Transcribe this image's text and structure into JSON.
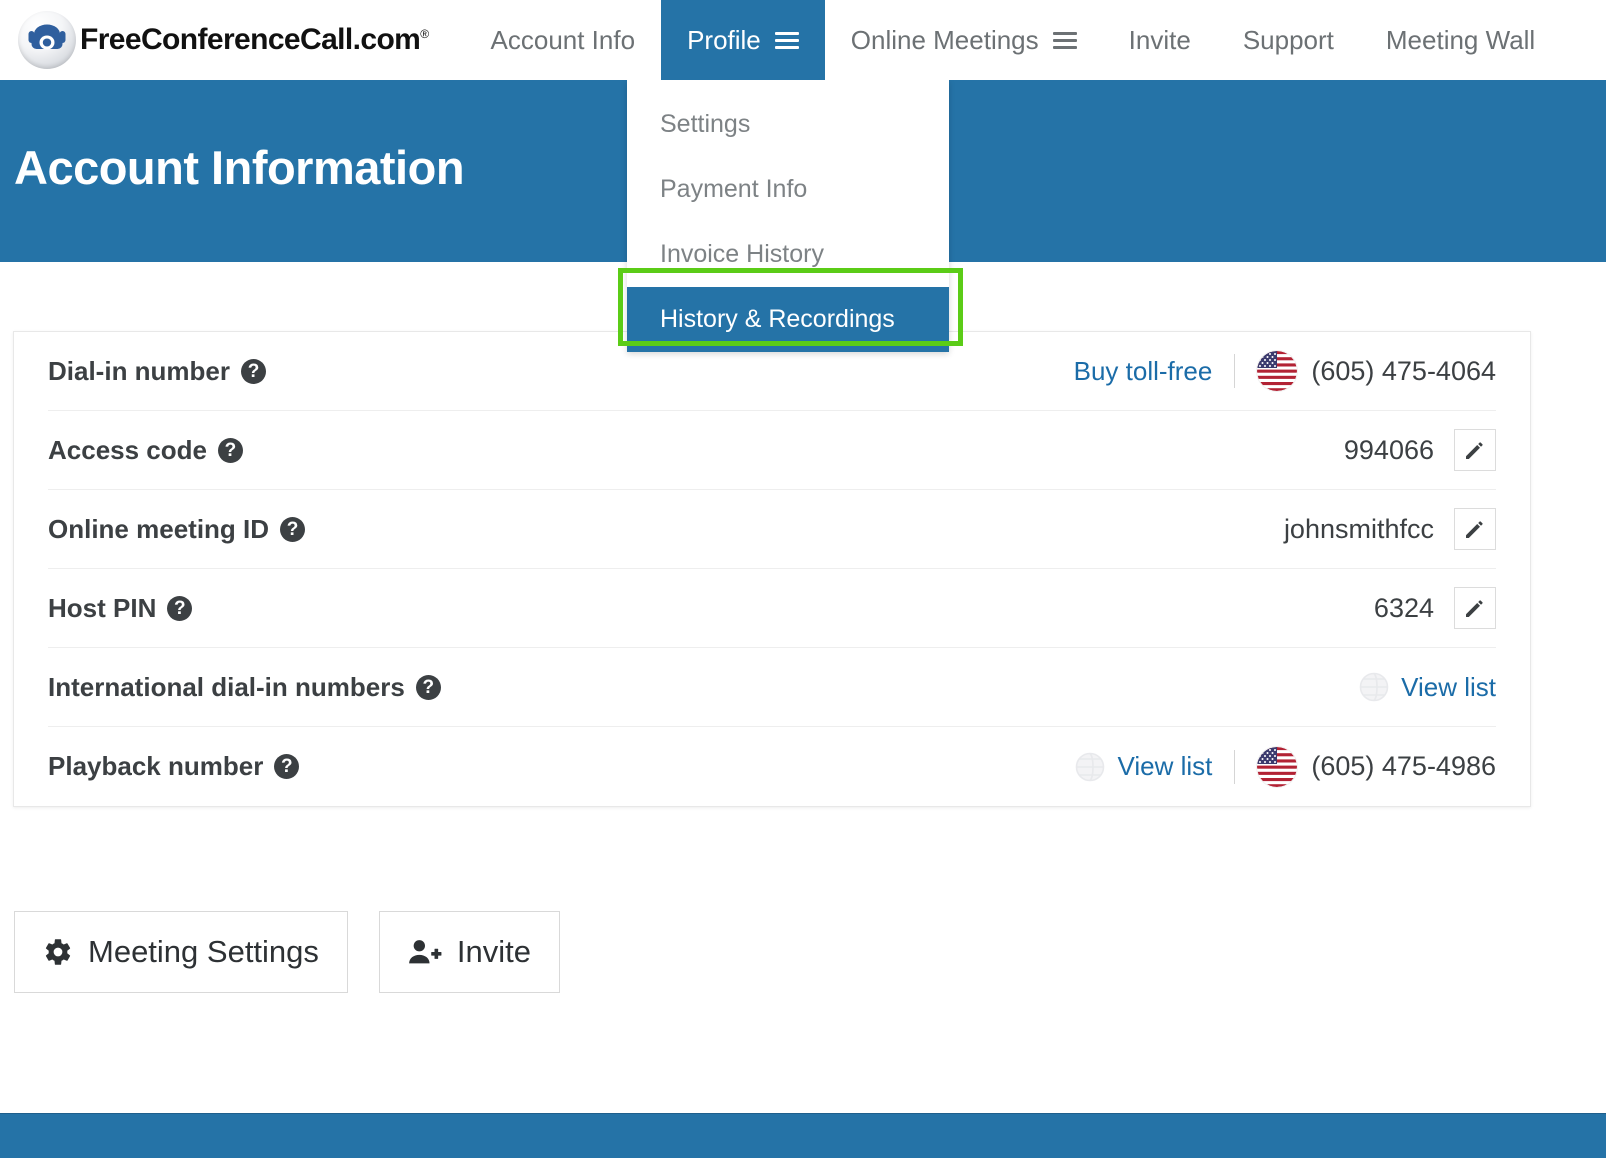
{
  "brand": {
    "name": "FreeConferenceCall.com",
    "registered_mark": "®",
    "logo_icon": "telephone-icon"
  },
  "nav": {
    "items": [
      {
        "label": "Account Info",
        "active": false,
        "has_menu": false
      },
      {
        "label": "Profile",
        "active": true,
        "has_menu": true
      },
      {
        "label": "Online Meetings",
        "active": false,
        "has_menu": true
      },
      {
        "label": "Invite",
        "active": false,
        "has_menu": false
      },
      {
        "label": "Support",
        "active": false,
        "has_menu": false
      },
      {
        "label": "Meeting Wall",
        "active": false,
        "has_menu": false
      }
    ]
  },
  "dropdown": {
    "items": [
      {
        "label": "Settings",
        "selected": false
      },
      {
        "label": "Payment Info",
        "selected": false
      },
      {
        "label": "Invoice History",
        "selected": false
      },
      {
        "label": "History & Recordings",
        "selected": true
      }
    ],
    "highlight_color": "#5bcc17"
  },
  "page": {
    "title": "Account Information",
    "header_color": "#2573a7"
  },
  "account_rows": [
    {
      "label": "Dial-in number",
      "help_icon": "question-mark-icon",
      "link": "Buy toll-free",
      "has_separator": true,
      "flag": "us-flag-icon",
      "value": "(605) 475-4064",
      "has_edit": false,
      "globe_link": null
    },
    {
      "label": "Access code",
      "help_icon": "question-mark-icon",
      "link": null,
      "has_separator": false,
      "flag": null,
      "value": "994066",
      "has_edit": true,
      "globe_link": null
    },
    {
      "label": "Online meeting ID",
      "help_icon": "question-mark-icon",
      "link": null,
      "has_separator": false,
      "flag": null,
      "value": "johnsmithfcc",
      "has_edit": true,
      "globe_link": null
    },
    {
      "label": "Host PIN",
      "help_icon": "question-mark-icon",
      "link": null,
      "has_separator": false,
      "flag": null,
      "value": "6324",
      "has_edit": true,
      "globe_link": null
    },
    {
      "label": "International dial-in numbers",
      "help_icon": "question-mark-icon",
      "link": null,
      "has_separator": false,
      "flag": null,
      "value": null,
      "has_edit": false,
      "globe_link": "View list"
    },
    {
      "label": "Playback number",
      "help_icon": "question-mark-icon",
      "link": null,
      "has_separator": true,
      "flag": "us-flag-icon",
      "value": "(605) 475-4986",
      "has_edit": false,
      "globe_link": "View list"
    }
  ],
  "actions": [
    {
      "label": "Meeting Settings",
      "icon": "gear-icon"
    },
    {
      "label": "Invite",
      "icon": "add-user-icon"
    }
  ],
  "colors": {
    "brand_blue": "#2573a7",
    "link_blue": "#1b6ca8",
    "highlight_green": "#5bcc17",
    "text_dark": "#3c4043"
  }
}
